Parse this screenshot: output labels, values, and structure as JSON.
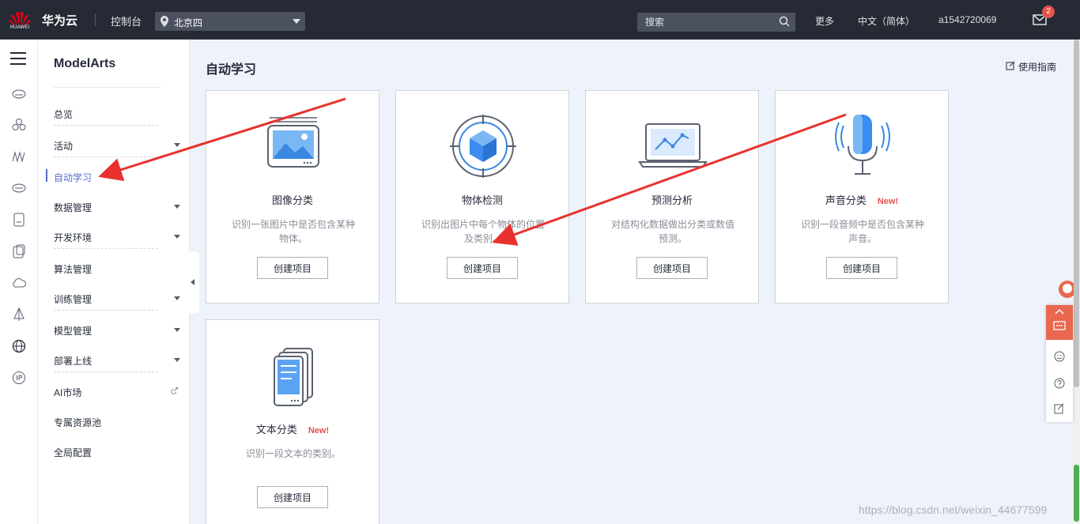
{
  "topbar": {
    "logo_text": "HUAWEI",
    "brand": "华为云",
    "console": "控制台",
    "region": "北京四",
    "search_placeholder": "搜索",
    "more": "更多",
    "language": "中文（简体）",
    "user": "a1542720069",
    "mail_count": "2"
  },
  "nav": {
    "title": "ModelArts",
    "items": [
      {
        "label": "总览"
      },
      {
        "label": "活动"
      },
      {
        "label": "自动学习"
      },
      {
        "label": "数据管理"
      },
      {
        "label": "开发环境"
      },
      {
        "label": "算法管理"
      },
      {
        "label": "训练管理"
      },
      {
        "label": "模型管理"
      },
      {
        "label": "部署上线"
      },
      {
        "label": "AI市场"
      },
      {
        "label": "专属资源池"
      },
      {
        "label": "全局配置"
      }
    ]
  },
  "main": {
    "title": "自动学习",
    "guide": "使用指南",
    "new_tag": "New!",
    "cards": [
      {
        "name": "图像分类",
        "desc": "识别一张图片中是否包含某种物体。",
        "button": "创建项目"
      },
      {
        "name": "物体检测",
        "desc": "识别出图片中每个物体的位置及类别。",
        "button": "创建项目"
      },
      {
        "name": "预测分析",
        "desc": "对结构化数据做出分类或数值预测。",
        "button": "创建项目"
      },
      {
        "name": "声音分类",
        "desc": "识别一段音频中是否包含某种声音。",
        "button": "创建项目"
      },
      {
        "name": "文本分类",
        "desc": "识别一段文本的类别。",
        "button": "创建项目"
      }
    ]
  },
  "watermark": "https://blog.csdn.net/weixin_44677599",
  "colors": {
    "topbar_bg": "#252a35",
    "accent": "#526ecc",
    "new_red": "#e5534b",
    "arrow_red": "#e8322e"
  }
}
